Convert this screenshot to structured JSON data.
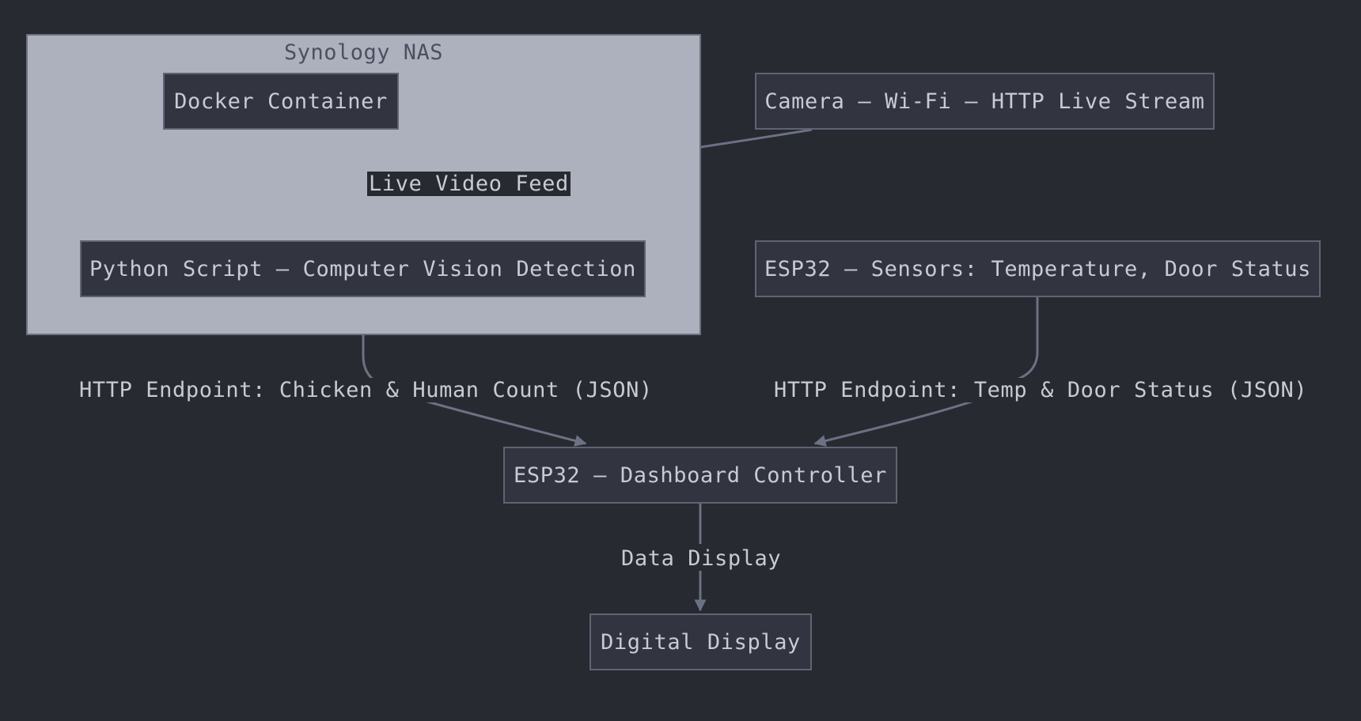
{
  "cluster": {
    "title": "Synology NAS"
  },
  "nodes": {
    "docker": "Docker Container",
    "python": "Python Script – Computer Vision Detection",
    "camera": "Camera – Wi-Fi – HTTP Live Stream",
    "esp32_sensors": "ESP32 – Sensors: Temperature, Door Status",
    "esp32_dashboard": "ESP32 – Dashboard Controller",
    "display": "Digital Display"
  },
  "edges": {
    "live_video": "Live Video Feed",
    "chicken_count": "HTTP Endpoint: Chicken & Human Count (JSON)",
    "temp_door": "HTTP Endpoint: Temp & Door Status (JSON)",
    "data_display": "Data Display"
  },
  "colors": {
    "background": "#282a31",
    "cluster_fill": "#adb1bd",
    "node_fill": "#323540",
    "edge": "#6c7284",
    "text": "#c8cbd4"
  }
}
